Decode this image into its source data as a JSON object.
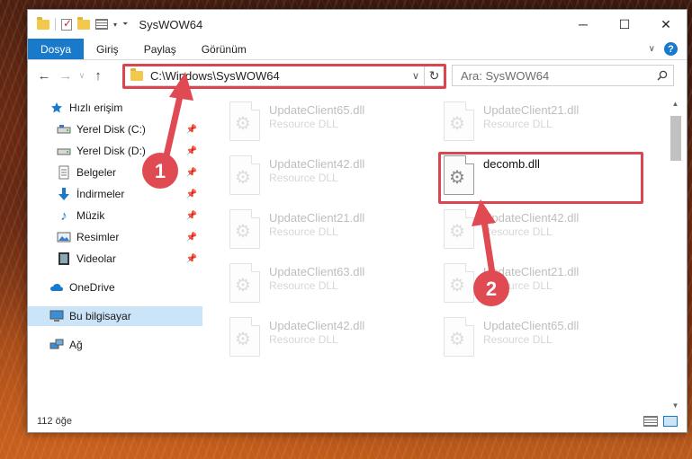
{
  "window": {
    "title": "SysWOW64",
    "controls": {
      "minimize": "─",
      "maximize": "☐",
      "close": "✕"
    }
  },
  "ribbon": {
    "tabs": [
      "Dosya",
      "Giriş",
      "Paylaş",
      "Görünüm"
    ],
    "help": "?"
  },
  "nav": {
    "address": "C:\\Windows\\SysWOW64",
    "search_placeholder": "Ara: SysWOW64"
  },
  "sidebar": {
    "items": [
      {
        "label": "Hızlı erişim",
        "icon": "star-icon",
        "pinned": false
      },
      {
        "label": "Yerel Disk (C:)",
        "icon": "drive-icon",
        "pinned": true
      },
      {
        "label": "Yerel Disk (D:)",
        "icon": "drive-icon",
        "pinned": true
      },
      {
        "label": "Belgeler",
        "icon": "documents-icon",
        "pinned": true
      },
      {
        "label": "İndirmeler",
        "icon": "download-icon",
        "pinned": true
      },
      {
        "label": "Müzik",
        "icon": "music-icon",
        "pinned": true
      },
      {
        "label": "Resimler",
        "icon": "pictures-icon",
        "pinned": true
      },
      {
        "label": "Videolar",
        "icon": "video-icon",
        "pinned": true
      },
      {
        "label": "OneDrive",
        "icon": "cloud-icon",
        "pinned": false
      },
      {
        "label": "Bu bilgisayar",
        "icon": "computer-icon",
        "pinned": false,
        "selected": true
      },
      {
        "label": "Ağ",
        "icon": "network-icon",
        "pinned": false
      }
    ]
  },
  "files": [
    {
      "name": "UpdateClient65.dll",
      "type": "Resource DLL"
    },
    {
      "name": "UpdateClient21.dll",
      "type": "Resource DLL"
    },
    {
      "name": "UpdateClient42.dll",
      "type": "Resource DLL"
    },
    {
      "name": "decomb.dll",
      "type": ""
    },
    {
      "name": "UpdateClient21.dll",
      "type": "Resource DLL"
    },
    {
      "name": "UpdateClient42.dll",
      "type": "Resource DLL"
    },
    {
      "name": "UpdateClient63.dll",
      "type": "Resource DLL"
    },
    {
      "name": "UpdateClient21.dll",
      "type": "Resource DLL"
    },
    {
      "name": "UpdateClient42.dll",
      "type": "Resource DLL"
    },
    {
      "name": "UpdateClient65.dll",
      "type": "Resource DLL"
    }
  ],
  "status": {
    "count": "112 öğe"
  },
  "annotations": {
    "step1": "1",
    "step2": "2"
  },
  "colors": {
    "accent": "#1979ca",
    "highlight": "#d9464f",
    "selection": "#cce4f7"
  }
}
